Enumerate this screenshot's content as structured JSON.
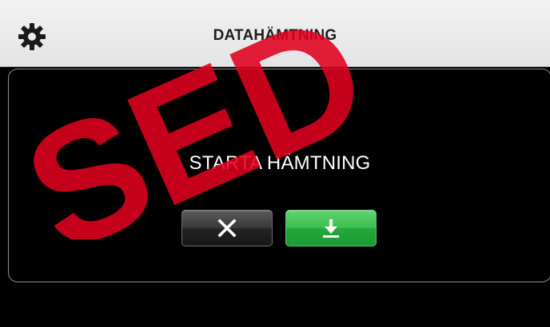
{
  "header": {
    "title": "DATAHÄMTNING",
    "settings_icon": "gear-icon"
  },
  "dialog": {
    "message": "STARTA HÄMTNING",
    "cancel_icon": "close-icon",
    "download_icon": "download-icon"
  },
  "watermark": {
    "text": "SED"
  },
  "colors": {
    "header_bg": "#e8e8e8",
    "background": "#000000",
    "dialog_border": "#8c8c8c",
    "cancel_button": "#2e2e2e",
    "download_button": "#34b548",
    "watermark": "#e0001e"
  }
}
